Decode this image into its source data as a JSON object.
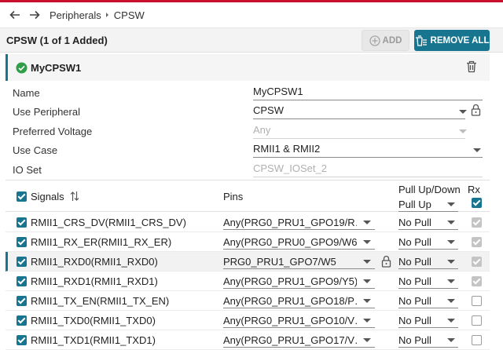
{
  "nav": {
    "breadcrumb": [
      "Peripherals",
      "CPSW"
    ]
  },
  "header": {
    "title": "CPSW (1 of 1 Added)",
    "add_label": "ADD",
    "remove_all_label": "REMOVE ALL"
  },
  "instance": {
    "name": "MyCPSW1"
  },
  "fields": {
    "name_label": "Name",
    "name_value": "MyCPSW1",
    "use_peripheral_label": "Use Peripheral",
    "use_peripheral_value": "CPSW",
    "preferred_voltage_label": "Preferred Voltage",
    "preferred_voltage_value": "Any",
    "use_case_label": "Use Case",
    "use_case_value": "RMII1 & RMII2",
    "io_set_label": "IO Set",
    "io_set_value": "CPSW_IOSet_2"
  },
  "table": {
    "col_signals": "Signals",
    "col_pins": "Pins",
    "col_pull": "Pull Up/Down",
    "pull_header_value": "Pull Up",
    "col_rx": "Rx",
    "rows": [
      {
        "signal": "RMII1_CRS_DV(RMII1_CRS_DV)",
        "pin": "Any(PRG0_PRU1_GPO19/R…",
        "pull": "No Pull",
        "rx": "grey",
        "locked": false
      },
      {
        "signal": "RMII1_RX_ER(RMII1_RX_ER)",
        "pin": "Any(PRG0_PRU0_GPO9/W6)",
        "pull": "No Pull",
        "rx": "grey",
        "locked": false
      },
      {
        "signal": "RMII1_RXD0(RMII1_RXD0)",
        "pin": "PRG0_PRU1_GPO7/W5",
        "pull": "No Pull",
        "rx": "grey",
        "locked": true
      },
      {
        "signal": "RMII1_RXD1(RMII1_RXD1)",
        "pin": "Any(PRG0_PRU1_GPO9/Y5)",
        "pull": "No Pull",
        "rx": "grey",
        "locked": false
      },
      {
        "signal": "RMII1_TX_EN(RMII1_TX_EN)",
        "pin": "Any(PRG0_PRU1_GPO18/P…",
        "pull": "No Pull",
        "rx": "off",
        "locked": false
      },
      {
        "signal": "RMII1_TXD0(RMII1_TXD0)",
        "pin": "Any(PRG0_PRU1_GPO10/V…",
        "pull": "No Pull",
        "rx": "off",
        "locked": false
      },
      {
        "signal": "RMII1_TXD1(RMII1_TXD1)",
        "pin": "Any(PRG0_PRU1_GPO17/V…",
        "pull": "No Pull",
        "rx": "off",
        "locked": false
      }
    ]
  },
  "colors": {
    "accent": "#17758f",
    "brand_bar": "#c8102e",
    "ok_green": "#2e9e48"
  }
}
